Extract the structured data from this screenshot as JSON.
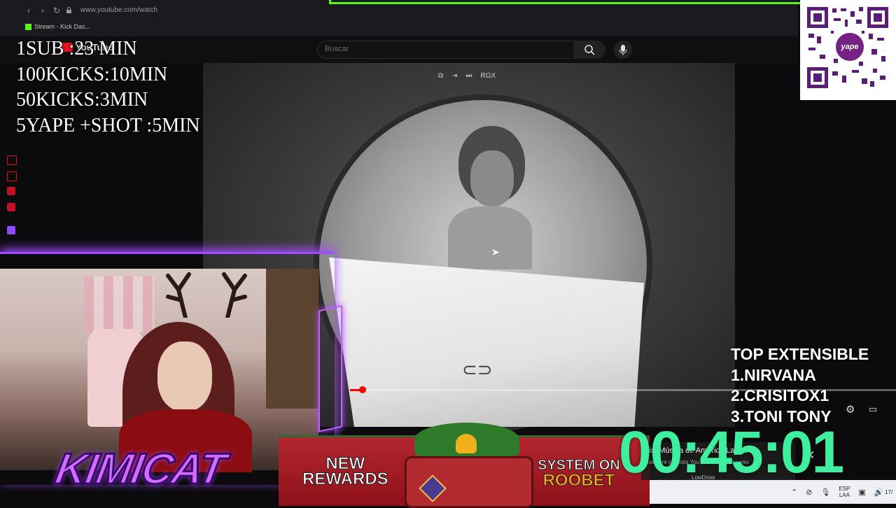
{
  "browser": {
    "url": "www.youtube.com/watch",
    "tab_title": "Stream - Kick Das...",
    "back_icon": "‹",
    "forward_icon": "›",
    "reload_icon": "↻"
  },
  "youtube": {
    "logo_text": "YouTube",
    "search_placeholder": "Buscar",
    "player_controls": [
      "⧉",
      "⇥",
      "⏭",
      "RGX"
    ]
  },
  "overlay": {
    "rules": "1SUB :23 MIN\n100KICKS:10MIN\n50KICKS:3MIN\n5YAPE +SHOT :5MIN"
  },
  "qr": {
    "badge_text": "yape",
    "accent": "#742284"
  },
  "webcam": {
    "streamer_logo": "KIMICAT"
  },
  "banner": {
    "left_line1": "NEW",
    "left_line2": "REWARDS",
    "right_line1": "SYSTEM ON",
    "right_line2": "ROOBET"
  },
  "top_list": {
    "title": "TOP EXTENSIBLE",
    "items": [
      "1.NIRVANA",
      "2.CRISITOX1",
      "3.TONI TONY"
    ]
  },
  "timer": {
    "value": "00:45:01",
    "color": "#3cf0a0"
  },
  "playlist": {
    "title": "Mix: Música de América Latina",
    "subtitle": "Mixes are playlists YouTube makes for you",
    "channel": "LowDrow"
  },
  "system_tray": {
    "lang_line1": "ESP",
    "lang_line2": "LAA",
    "date": "17/"
  },
  "colors": {
    "kick_green": "#53fc18",
    "neon_purple": "#a14bff",
    "youtube_red": "#ff0000"
  }
}
